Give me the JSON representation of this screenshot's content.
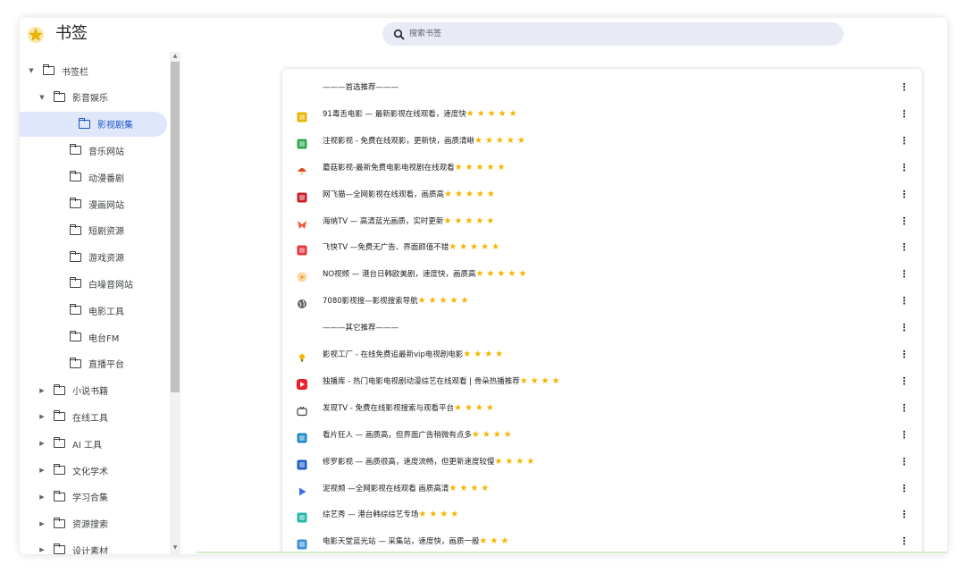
{
  "app": {
    "title": "书签",
    "logo_icon": "bookmarks-star-icon",
    "accent_color": "#1a56c4",
    "selected_bg": "#e0e7fb",
    "star_color": "#f4b400"
  },
  "search": {
    "placeholder": "搜索书签",
    "icon": "search-icon"
  },
  "sidebar": {
    "items": [
      {
        "label": "书签栏",
        "expanded": true,
        "level": 0
      },
      {
        "label": "影音娱乐",
        "expanded": true,
        "level": 1
      },
      {
        "label": "影视剧集",
        "selected": true,
        "level": 2
      },
      {
        "label": "音乐网站",
        "level": 2
      },
      {
        "label": "动漫番剧",
        "level": 2
      },
      {
        "label": "漫画网站",
        "level": 2
      },
      {
        "label": "短剧资源",
        "level": 2
      },
      {
        "label": "游戏资源",
        "level": 2
      },
      {
        "label": "白噪音网站",
        "level": 2
      },
      {
        "label": "电影工具",
        "level": 2
      },
      {
        "label": "电台FM",
        "level": 2
      },
      {
        "label": "直播平台",
        "level": 2
      },
      {
        "label": "小说书籍",
        "expanded": false,
        "level": 1
      },
      {
        "label": "在线工具",
        "expanded": false,
        "level": 1
      },
      {
        "label": "AI 工具",
        "expanded": false,
        "level": 1
      },
      {
        "label": "文化学术",
        "expanded": false,
        "level": 1
      },
      {
        "label": "学习合集",
        "expanded": false,
        "level": 1
      },
      {
        "label": "资源搜索",
        "expanded": false,
        "level": 1
      },
      {
        "label": "设计素材",
        "expanded": false,
        "level": 1
      }
    ]
  },
  "bookmarks": [
    {
      "title": "———首选推荐———",
      "stars": "",
      "icon": "none",
      "color": ""
    },
    {
      "title": "91毒舌电影 — 最新影视在线观看，速度快",
      "stars": "★★★★★",
      "icon": "yellow-box-icon",
      "color": "#e8b400"
    },
    {
      "title": "注视影视 - 免费在线观影，更新快，画质清晰",
      "stars": "★★★★★",
      "icon": "green-g-icon",
      "color": "#2fa84f"
    },
    {
      "title": "蘑菇影视-最新免费电影电视剧在线观看",
      "stars": "★★★★★",
      "icon": "mushroom-icon",
      "color": "#e04a2a"
    },
    {
      "title": "网飞猫—全网影视在线观看，画质高",
      "stars": "★★★★★",
      "icon": "netflix-cat-icon",
      "color": "#c7202a"
    },
    {
      "title": "海纳TV — 高清蓝光画质，实时更新",
      "stars": "★★★★★",
      "icon": "haina-tv-icon",
      "color": "#ef5a3c"
    },
    {
      "title": "飞快TV —免费无广告、界面颜值不错",
      "stars": "★★★★★",
      "icon": "feikuai-tv-icon",
      "color": "#e8323c"
    },
    {
      "title": "NO视频 — 港台日韩欧美剧，速度快，画质高",
      "stars": "★★★★★",
      "icon": "play-orange-icon",
      "color": "#f39c34"
    },
    {
      "title": "7080影视搜—影视搜索导航",
      "stars": "★★★★★",
      "icon": "globe-icon",
      "color": "#5f6368"
    },
    {
      "title": "———其它推荐———",
      "stars": "",
      "icon": "none",
      "color": ""
    },
    {
      "title": "影视工厂 - 在线免费追最新vip电视剧电影",
      "stars": "★★★★",
      "icon": "bulb-icon",
      "color": "#f4b400"
    },
    {
      "title": "独播库 - 热门电影电视剧动漫综艺在线观看 | 骨朵热播推荐",
      "stars": "★★★★",
      "icon": "play-red-icon",
      "color": "#e8222c"
    },
    {
      "title": "发现TV - 免费在线影视搜索与观看平台",
      "stars": "★★★★",
      "icon": "tv-icon",
      "color": "#3c4043"
    },
    {
      "title": "看片狂人 — 画质高，但界面广告稍微有点多",
      "stars": "★★★★",
      "icon": "kanpian-icon",
      "color": "#1f8ac6"
    },
    {
      "title": "修罗影视 — 画质很高，速度流畅，但更新速度较慢",
      "stars": "★★★★",
      "icon": "xiuluo-icon",
      "color": "#1e5fc8"
    },
    {
      "title": "泥视频 —全网影视在线观看 画质高清",
      "stars": "★★★★",
      "icon": "play-blue-icon",
      "color": "#3b6ce8"
    },
    {
      "title": "综艺秀 — 港台韩综综艺专场",
      "stars": "★★★★",
      "icon": "zongyi-icon",
      "color": "#26b6a6"
    },
    {
      "title": "电影天堂蓝光站 — 采集站，速度快，画质一般",
      "stars": "★★★",
      "icon": "dytt-icon",
      "color": "#3f8fd6"
    }
  ]
}
